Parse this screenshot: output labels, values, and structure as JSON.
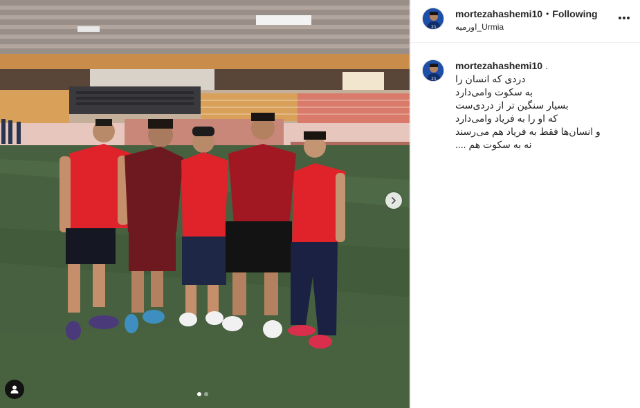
{
  "post": {
    "username": "mortezahashemi10",
    "separator": "•",
    "follow_status": "Following",
    "location": "اورمیه_Urmia"
  },
  "caption": {
    "username": "mortezahashemi10",
    "suffix": " .",
    "lines": [
      "دردی که انسان را",
      "به سکوت وامی‌دارد",
      "بسیار سنگین تر از دردی‌ست",
      "که او را به فریاد وامی‌دارد",
      "و انسان‌ها فقط به فریاد هم می‌رسند",
      "نه به سکوت هم ...."
    ]
  },
  "media": {
    "slide_count": 2,
    "current_slide": 1
  },
  "icons": {
    "more": "more-options-icon",
    "next": "chevron-right-icon",
    "tag": "user-tag-icon"
  },
  "colors": {
    "jersey_red": "#e0232b",
    "pitch_green": "#47603f",
    "seats_orange": "#d9a05a"
  }
}
